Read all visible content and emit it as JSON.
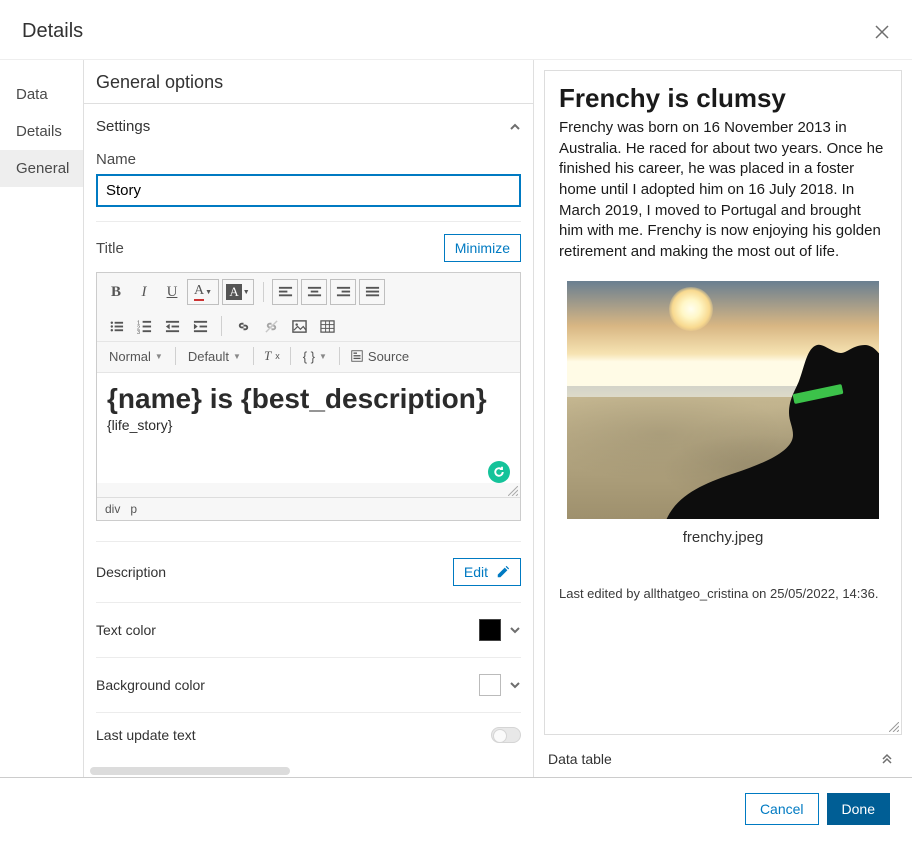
{
  "dialog": {
    "title": "Details"
  },
  "tabs": {
    "data": "Data",
    "details": "Details",
    "general": "General"
  },
  "general": {
    "title": "General options",
    "settings_label": "Settings",
    "name_label": "Name",
    "name_value": "Story",
    "title_label": "Title",
    "minimize": "Minimize",
    "format_normal": "Normal",
    "format_default": "Default",
    "source": "Source",
    "editor_heading": "{name} is {best_description}",
    "editor_body": "{life_story}",
    "path_div": "div",
    "path_p": "p",
    "description_label": "Description",
    "edit": "Edit",
    "text_color_label": "Text color",
    "bg_color_label": "Background color",
    "last_update_label": "Last update text"
  },
  "preview": {
    "heading": "Frenchy is clumsy",
    "body": "Frenchy was born on 16 November 2013 in Australia. He raced for about two years. Once he finished his career, he was placed in a foster home until I adopted him on 16 July 2018. In March 2019, I moved to Portugal and brought him with me. Frenchy is now enjoying his golden retirement and making the most out of life.",
    "image_caption": "frenchy.jpeg",
    "last_edited": "Last edited by allthatgeo_cristina on 25/05/2022, 14:36.",
    "data_table": "Data table"
  },
  "footer": {
    "cancel": "Cancel",
    "done": "Done"
  },
  "colors": {
    "text": "#000000",
    "background": "#ffffff",
    "accent": "#007ac2",
    "primary": "#005e95"
  }
}
